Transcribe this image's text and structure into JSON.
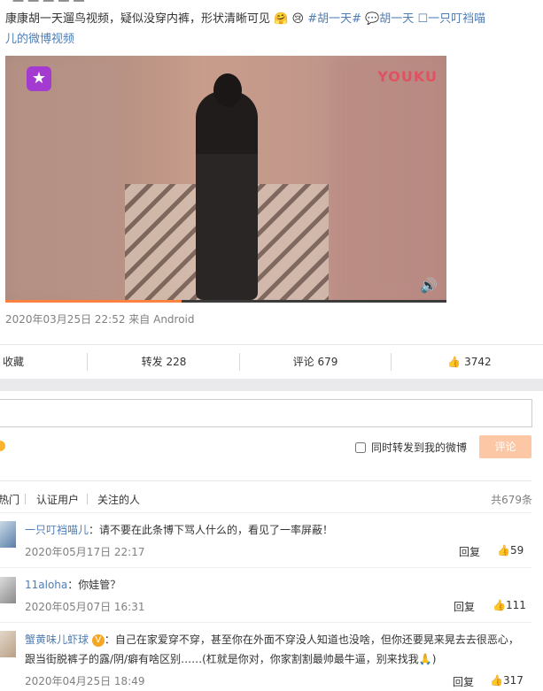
{
  "post": {
    "top_cut": "一 一 一 一 一",
    "text": "康康胡一天遛鸟视频，疑似没穿内裤，形状清晰可见",
    "emoji_1": "🤗",
    "emoji_2": "😢",
    "tag_1": "#胡一天#",
    "tag_2": "💬胡一天",
    "link_line1": "☐一只叮裆喵",
    "link_line2": "儿的微博视频",
    "video": {
      "brand": "YOUKU",
      "app_icon": "star-logo",
      "volume_icon": "🔊",
      "progress": 0.4
    },
    "meta": "2020年03月25日 22:52  来自 Android"
  },
  "actions": {
    "collect": "收藏",
    "forward": "转发 228",
    "comment": "评论 679",
    "like": "3742"
  },
  "compose": {
    "placeholder": "",
    "sync_label": "同时转发到我的微博",
    "submit": "评论"
  },
  "filters": {
    "hot": "热门",
    "verified": "认证用户",
    "following": "关注的人",
    "total": "共679条"
  },
  "comments": [
    {
      "user": "一只叮裆喵儿",
      "text": "：请不要在此条博下骂人什么的，看见了一率屏蔽！",
      "time": "2020年05月17日 22:17",
      "reply": "回复",
      "likes": "59"
    },
    {
      "user": "11aloha",
      "text": "：你娃管？",
      "time": "2020年05月07日 16:31",
      "reply": "回复",
      "likes": "111"
    },
    {
      "user": "蟹黄味儿虾球",
      "badge": "V",
      "text": "：自己在家爱穿不穿，甚至你在外面不穿没人知道也没啥，但你还要晃来晃去去很恶心，",
      "text2": "跟当街脱裤子的露/阴/癖有啥区别……(杠就是你对，你家割割最帅最牛逼，别来找我🙏)",
      "time": "2020年04月25日 18:49",
      "reply": "回复",
      "likes": "317"
    }
  ],
  "colors": {
    "link": "#4f7db5",
    "accent": "#ff8140",
    "button_disabled": "#fcc7a5"
  }
}
